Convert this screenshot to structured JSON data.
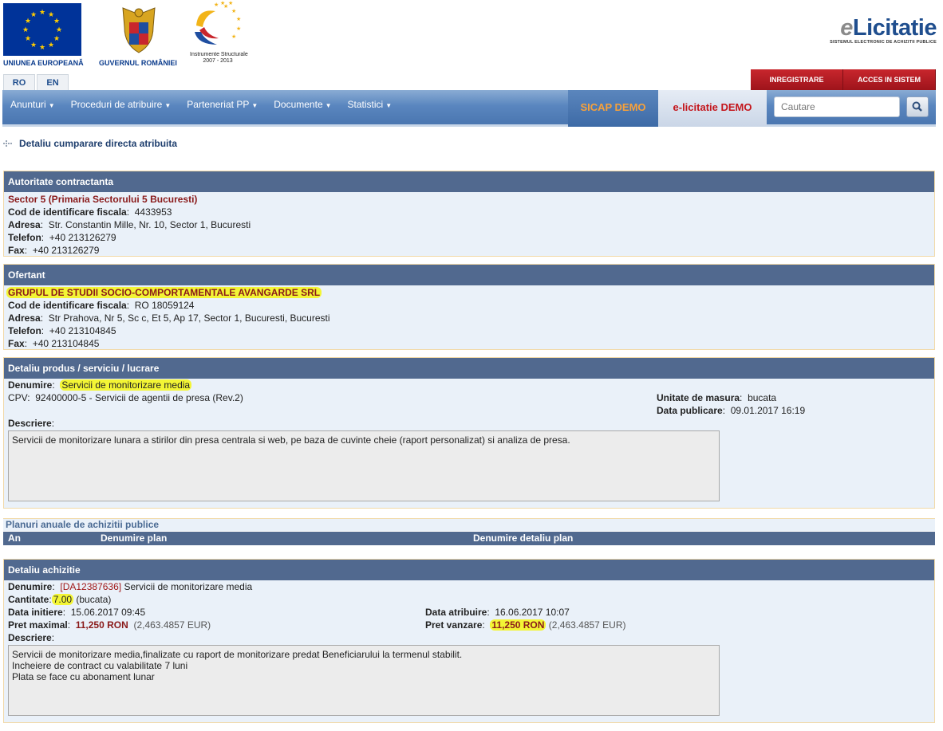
{
  "logos": {
    "eu_caption": "UNIUNEA EUROPEANĂ",
    "gov_caption": "GUVERNUL ROMÂNIEI",
    "instr_caption_1": "Instrumente Structurale",
    "instr_caption_2": "2007 - 2013",
    "brand_e": "e",
    "brand_main": "Licitatie",
    "brand_sub": "SISTEMUL ELECTRONIC DE ACHIZITII PUBLICE"
  },
  "lang": [
    "RO",
    "EN"
  ],
  "top_buttons": {
    "register": "INREGISTRARE",
    "login": "ACCES IN SISTEM"
  },
  "nav": {
    "items": [
      "Anunturi",
      "Proceduri de atribuire",
      "Parteneriat PP",
      "Documente",
      "Statistici"
    ],
    "sicap": "SICAP DEMO",
    "elic": "e-licitatie DEMO",
    "search_placeholder": "Cautare"
  },
  "breadcrumb": "Detaliu cumparare directa atribuita",
  "authority": {
    "header": "Autoritate contractanta",
    "name": "Sector 5 (Primaria Sectorului 5 Bucuresti)",
    "cif_label": "Cod de identificare fiscala",
    "cif": "4433953",
    "address_label": "Adresa",
    "address": "Str. Constantin Mille, Nr. 10, Sector 1, Bucuresti",
    "phone_label": "Telefon",
    "phone": "+40 213126279",
    "fax_label": "Fax",
    "fax": "+40 213126279"
  },
  "bidder": {
    "header": "Ofertant",
    "name": "GRUPUL DE STUDII SOCIO-COMPORTAMENTALE AVANGARDE SRL",
    "cif_label": "Cod de identificare fiscala",
    "cif": "RO 18059124",
    "address_label": "Adresa",
    "address": "Str Prahova, Nr 5, Sc c, Et 5, Ap 17, Sector 1, Bucuresti, Bucuresti",
    "phone_label": "Telefon",
    "phone": "+40 213104845",
    "fax_label": "Fax",
    "fax": "+40 213104845"
  },
  "product": {
    "header": "Detaliu produs / serviciu / lucrare",
    "name_label": "Denumire",
    "name": "Servicii de monitorizare media",
    "cpv_label": "CPV",
    "cpv": "92400000-5 -  Servicii de agentii de presa (Rev.2)",
    "unit_label": "Unitate de masura",
    "unit": "bucata",
    "pub_label": "Data publicare",
    "pub": "09.01.2017 16:19",
    "desc_label": "Descriere",
    "desc": "Servicii de monitorizare lunara a stirilor din presa centrala si web, pe baza de cuvinte cheie (raport personalizat) si analiza de presa."
  },
  "plans": {
    "title": "Planuri anuale de achizitii publice",
    "col_year": "An",
    "col_plan": "Denumire plan",
    "col_detail": "Denumire detaliu plan"
  },
  "acquisition": {
    "header": "Detaliu achizitie",
    "name_label": "Denumire",
    "code": "[DA12387636]",
    "name": "Servicii de monitorizare media",
    "qty_label": "Cantitate",
    "qty": "7.00",
    "qty_unit": "(bucata)",
    "init_label": "Data initiere",
    "init": "15.06.2017 09:45",
    "award_label": "Data atribuire",
    "award": "16.06.2017 10:07",
    "max_label": "Pret maximal",
    "max_price": "11,250 RON",
    "max_eur": "(2,463.4857 EUR)",
    "sell_label": "Pret vanzare",
    "sell_price": "11,250 RON",
    "sell_eur": "(2,463.4857 EUR)",
    "desc_label": "Descriere",
    "desc": "Servicii de monitorizare media,finalizate cu raport de monitorizare predat Beneficiarului la termenul stabilit.\nIncheiere de contract cu valabilitate 7 luni\nPlata se face cu abonament lunar"
  }
}
